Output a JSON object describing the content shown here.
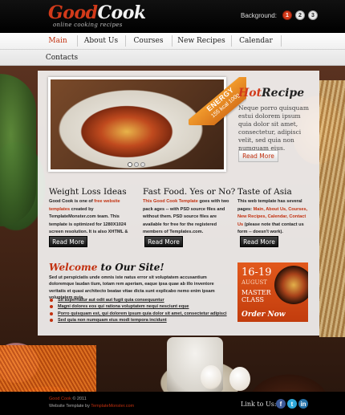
{
  "header": {
    "logo_part1": "Good",
    "logo_part2": "Cook",
    "tagline": "online cooking recipes",
    "background_label": "Background:",
    "background_options": [
      "1",
      "2",
      "3"
    ]
  },
  "nav": {
    "items": [
      "Main",
      "About Us",
      "Courses",
      "New Recipes",
      "Calendar",
      "Contacts"
    ],
    "active": "Main"
  },
  "slider": {
    "ribbon_line1": "ENERGY",
    "ribbon_line2": "155 kcal 100g",
    "dots": 3,
    "active_dot": 1
  },
  "hot_recipe": {
    "title_part1": "Hot",
    "title_part2": "Recipe",
    "text": "Neque porro quisquam estui dolorem ipsum quia dolor sit amet, consectetur, adipisci velit, sed quia non numquam eius.",
    "button": "Read More"
  },
  "columns": [
    {
      "title": "Weight Loss Ideas",
      "text_pre": "Good Cook is one of ",
      "text_link": "free website templates",
      "text_post": " created by TemplateMonster.com team. This template is optimized for 1280X1024 screen resolution. It is also XHTML & CSS valid.",
      "button": "Read More"
    },
    {
      "title": "Fast Food. Yes or No?",
      "text_pre": "",
      "text_link": "This Good Cook Template",
      "text_post": " goes with two pack ages -- with PSD source files and without them. PSD source files are available for free for the registered members of Templates.com.",
      "button": "Read More"
    },
    {
      "title": "Taste of Asia",
      "text_pre": "This web template has several pages: ",
      "text_link": "Main, About Us, Courses, New Recipes, Calendar, Contact Us",
      "text_post": " (please note that contact us form -- doesn't work).",
      "button": "Read More"
    }
  ],
  "welcome": {
    "title_part1": "Welcome",
    "title_part2": " to Our Site!",
    "text": "Sed ut perspiciatis unde omnis iste natus error sit voluptatem accusantium doloremque laudan tium, totam rem aperiam, eaque ipsa quae ab illo inventore veritatis et quasi architecto beatae vitae dicta sunt explicabo nemo enim ipsam voluptatem quia.",
    "bullets": [
      "Sit aspernatur aut odit aut fugit quia consequuntur",
      "Magni dolores eos qui rationa voluptatem nequi nesciunt eque",
      "Porro quisquam est, qui dolorem ipsum quia dolor sit amet, consectetur adipisci",
      "Sed quia non numquam eius modi tempora incidunt"
    ]
  },
  "banner": {
    "date": "16-19",
    "month": "AUGUST",
    "line1": "MASTER",
    "line2": "CLASS",
    "cta": "Order Now"
  },
  "footer": {
    "brand": "Good Cook",
    "copyright": " © 2011",
    "template_by_prefix": "Website Template by ",
    "template_by_link": "TemplateMonster.com",
    "link_us": "Link to Us:",
    "social": [
      "f",
      "t",
      "in"
    ]
  }
}
